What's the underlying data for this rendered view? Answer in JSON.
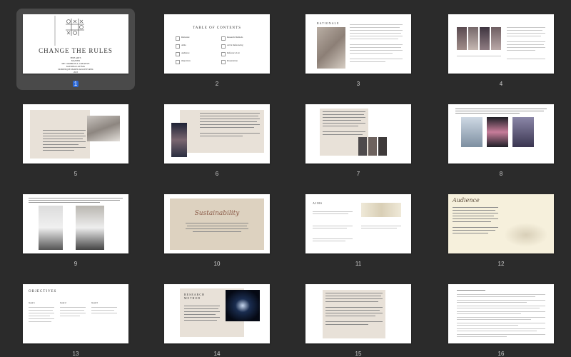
{
  "app": {
    "selected_slide": 1
  },
  "colors": {
    "background": "#2b2b2b",
    "selection": "#2c68d6",
    "beige": "#e8e1d8",
    "cream": "#f6f0dc"
  },
  "slides": [
    {
      "number": "1",
      "title": "CHANGE THE RULES",
      "subtitle_lines": [
        "FINE ARTS",
        "MASTER",
        "ME CAMERON A. CREATIVE",
        "KATRINA LATTMA",
        "DOMINIQUE MAREK & KONTUREK",
        "2023"
      ]
    },
    {
      "number": "2",
      "title": "TABLE OF CONTENTS",
      "items": [
        "Rationale",
        "Research Methods",
        "Aims",
        "Art & Referencing",
        "Audience",
        "Reference List",
        "Objectives",
        "Presentation"
      ]
    },
    {
      "number": "3",
      "title": "RATIONALE"
    },
    {
      "number": "4"
    },
    {
      "number": "5"
    },
    {
      "number": "6"
    },
    {
      "number": "7"
    },
    {
      "number": "8"
    },
    {
      "number": "9"
    },
    {
      "number": "10",
      "title": "Sustainability"
    },
    {
      "number": "11",
      "title": "AIMS"
    },
    {
      "number": "12",
      "title": "Audience"
    },
    {
      "number": "13",
      "title": "OBJECTIVES",
      "cols": [
        "Goal 1",
        "Goal 2",
        "Goal 3"
      ]
    },
    {
      "number": "14",
      "title": "RESEARCH METHOD"
    },
    {
      "number": "15"
    },
    {
      "number": "16"
    }
  ]
}
